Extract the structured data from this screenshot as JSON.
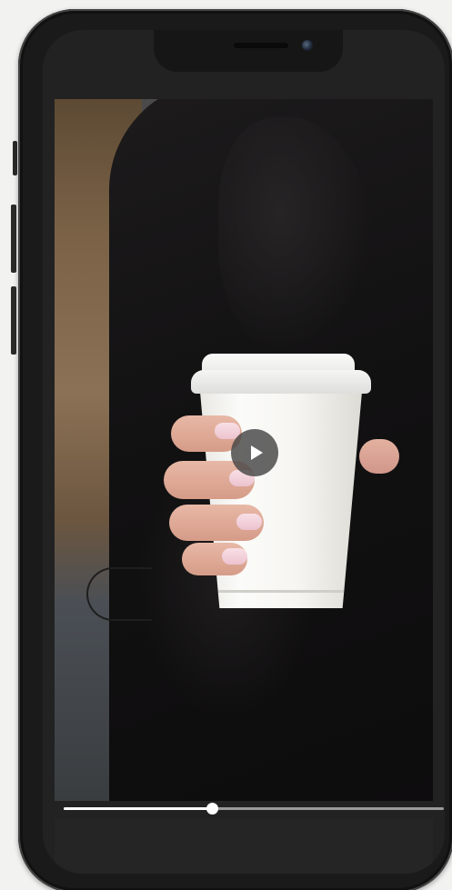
{
  "player": {
    "state": "paused",
    "progress_fraction": 0.39,
    "play_icon": "play-icon"
  },
  "colors": {
    "phone_frame": "#1a1a1a",
    "progress_track": "#9a9a9a",
    "progress_fill": "#ffffff",
    "play_button_bg": "#464646"
  }
}
